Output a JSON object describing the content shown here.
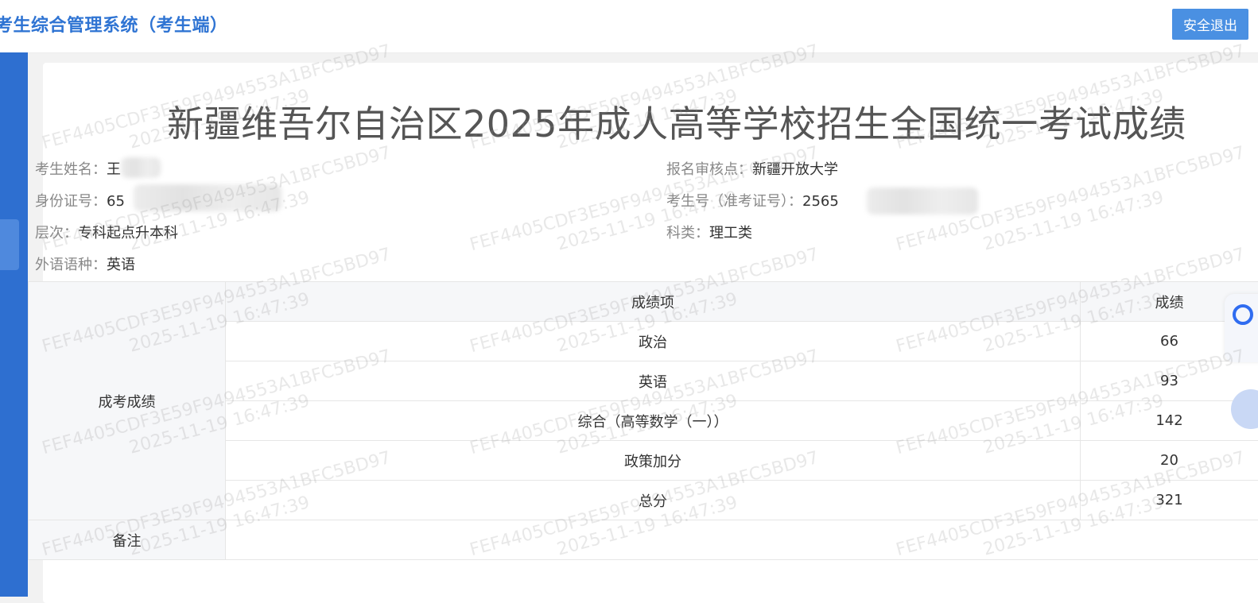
{
  "header": {
    "app_title": "考生综合管理系统（考生端）",
    "logout_label": "安全退出"
  },
  "page": {
    "title": "新疆维吾尔自治区2025年成人高等学校招生全国统一考试成绩"
  },
  "info": {
    "name_label": "考生姓名：",
    "name_value": "王",
    "idcard_label": "身份证号：",
    "idcard_value": "65",
    "level_label": "层次：",
    "level_value": "专科起点升本科",
    "language_label": "外语语种：",
    "language_value": "英语",
    "review_label": "报名审核点：",
    "review_value": "新疆开放大学",
    "exam_no_label": "考生号（准考证号）：",
    "exam_no_value": "2565",
    "category_label": "科类：",
    "category_value": "理工类"
  },
  "scores": {
    "header_item": "成绩项",
    "header_score": "成绩",
    "group_label": "成考成绩",
    "rows": [
      {
        "item": "政治",
        "score": "66"
      },
      {
        "item": "英语",
        "score": "93"
      },
      {
        "item": "综合（高等数学（一））",
        "score": "142"
      },
      {
        "item": "政策加分",
        "score": "20"
      },
      {
        "item": "总分",
        "score": "321"
      }
    ],
    "remark_label": "备注",
    "remark_value": ""
  },
  "watermark": {
    "code": "FEF4405CDF3E59F9494553A1BFC5BD97",
    "timestamp": "2025-11-19 16:47:39"
  },
  "colors": {
    "brand": "#2f74d3",
    "sidebar": "#2e6fd0",
    "button": "#4a90e2"
  }
}
